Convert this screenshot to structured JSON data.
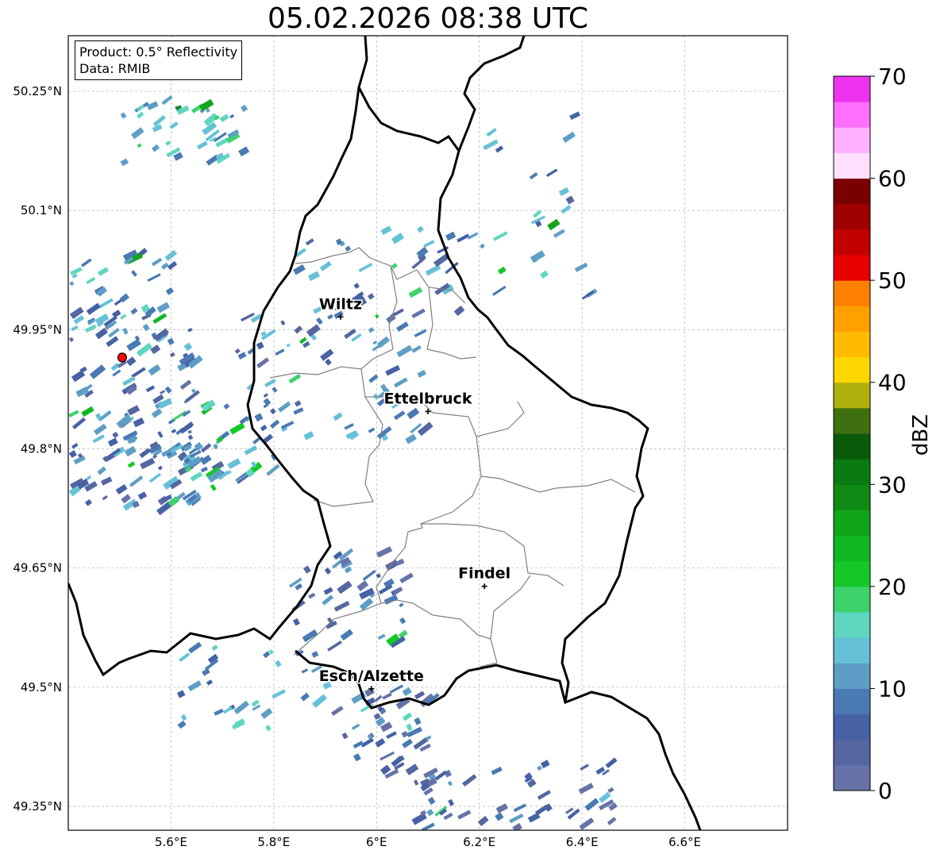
{
  "title": "05.02.2026 08:38 UTC",
  "infobox": {
    "product": "Product: 0.5° Reflectivity",
    "data": "Data: RMIB"
  },
  "colorbar": {
    "label": "dBZ",
    "min": 0,
    "max": 70,
    "step": 2.5,
    "ticks": [
      "0",
      "10",
      "20",
      "30",
      "40",
      "50",
      "60",
      "70"
    ],
    "colors": [
      "#6573a8",
      "#5566a0",
      "#4661a4",
      "#4a7ab3",
      "#5e9ec6",
      "#66c1d8",
      "#5fd6c0",
      "#3ed26c",
      "#14c927",
      "#10b823",
      "#12a41a",
      "#0f8a15",
      "#0a7a12",
      "#0a5a0a",
      "#3f7010",
      "#b0b00d",
      "#ffd700",
      "#ffbb00",
      "#ffa000",
      "#ff8000",
      "#e60000",
      "#c20000",
      "#a00000",
      "#7a0000",
      "#ffe0ff",
      "#ffb0ff",
      "#ff70ff",
      "#ee33ee"
    ]
  },
  "map": {
    "lon_range": [
      5.4,
      6.8
    ],
    "lat_range": [
      49.32,
      50.32
    ],
    "lon_ticks": [
      {
        "value": 5.6,
        "label": "5.6°E"
      },
      {
        "value": 5.8,
        "label": "5.8°E"
      },
      {
        "value": 6.0,
        "label": "6°E"
      },
      {
        "value": 6.2,
        "label": "6.2°E"
      },
      {
        "value": 6.4,
        "label": "6.4°E"
      },
      {
        "value": 6.6,
        "label": "6.6°E"
      }
    ],
    "lat_ticks": [
      {
        "value": 49.35,
        "label": "49.35°N"
      },
      {
        "value": 49.5,
        "label": "49.5°N"
      },
      {
        "value": 49.65,
        "label": "49.65°N"
      },
      {
        "value": 49.8,
        "label": "49.8°N"
      },
      {
        "value": 49.95,
        "label": "49.95°N"
      },
      {
        "value": 50.1,
        "label": "50.1°N"
      },
      {
        "value": 50.25,
        "label": "50.25°N"
      }
    ],
    "cities": [
      {
        "name": "Wiltz",
        "lon": 5.93,
        "lat": 49.966
      },
      {
        "name": "Ettelbruck",
        "lon": 6.1,
        "lat": 49.847
      },
      {
        "name": "Findel",
        "lon": 6.21,
        "lat": 49.627
      },
      {
        "name": "Esch/Alzette",
        "lon": 5.99,
        "lat": 49.498
      }
    ],
    "radar_site": {
      "lon": 5.505,
      "lat": 49.915
    },
    "echo_regions": [
      {
        "lon": 5.52,
        "lat": 49.85,
        "rlon": 0.12,
        "rlat": 0.13,
        "n": 110,
        "mean_dbz": 8
      },
      {
        "lon": 5.6,
        "lat": 49.78,
        "rlon": 0.1,
        "rlat": 0.05,
        "n": 40,
        "mean_dbz": 7
      },
      {
        "lon": 5.7,
        "lat": 49.82,
        "rlon": 0.1,
        "rlat": 0.06,
        "n": 40,
        "mean_dbz": 10
      },
      {
        "lon": 5.62,
        "lat": 50.2,
        "rlon": 0.12,
        "rlat": 0.04,
        "n": 40,
        "mean_dbz": 14
      },
      {
        "lon": 5.5,
        "lat": 50.0,
        "rlon": 0.1,
        "rlat": 0.05,
        "n": 35,
        "mean_dbz": 11
      },
      {
        "lon": 5.9,
        "lat": 49.89,
        "rlon": 0.18,
        "rlat": 0.08,
        "n": 70,
        "mean_dbz": 8
      },
      {
        "lon": 5.93,
        "lat": 49.6,
        "rlon": 0.12,
        "rlat": 0.07,
        "n": 45,
        "mean_dbz": 6
      },
      {
        "lon": 6.0,
        "lat": 49.44,
        "rlon": 0.1,
        "rlat": 0.06,
        "n": 45,
        "mean_dbz": 5
      },
      {
        "lon": 6.18,
        "lat": 49.36,
        "rlon": 0.12,
        "rlat": 0.04,
        "n": 30,
        "mean_dbz": 5
      },
      {
        "lon": 6.38,
        "lat": 49.36,
        "rlon": 0.08,
        "rlat": 0.05,
        "n": 20,
        "mean_dbz": 5
      },
      {
        "lon": 6.0,
        "lat": 50.02,
        "rlon": 0.18,
        "rlat": 0.06,
        "n": 35,
        "mean_dbz": 9
      },
      {
        "lon": 6.3,
        "lat": 50.1,
        "rlon": 0.12,
        "rlat": 0.12,
        "n": 25,
        "mean_dbz": 10
      },
      {
        "lon": 5.75,
        "lat": 49.5,
        "rlon": 0.15,
        "rlat": 0.05,
        "n": 30,
        "mean_dbz": 12
      }
    ]
  }
}
